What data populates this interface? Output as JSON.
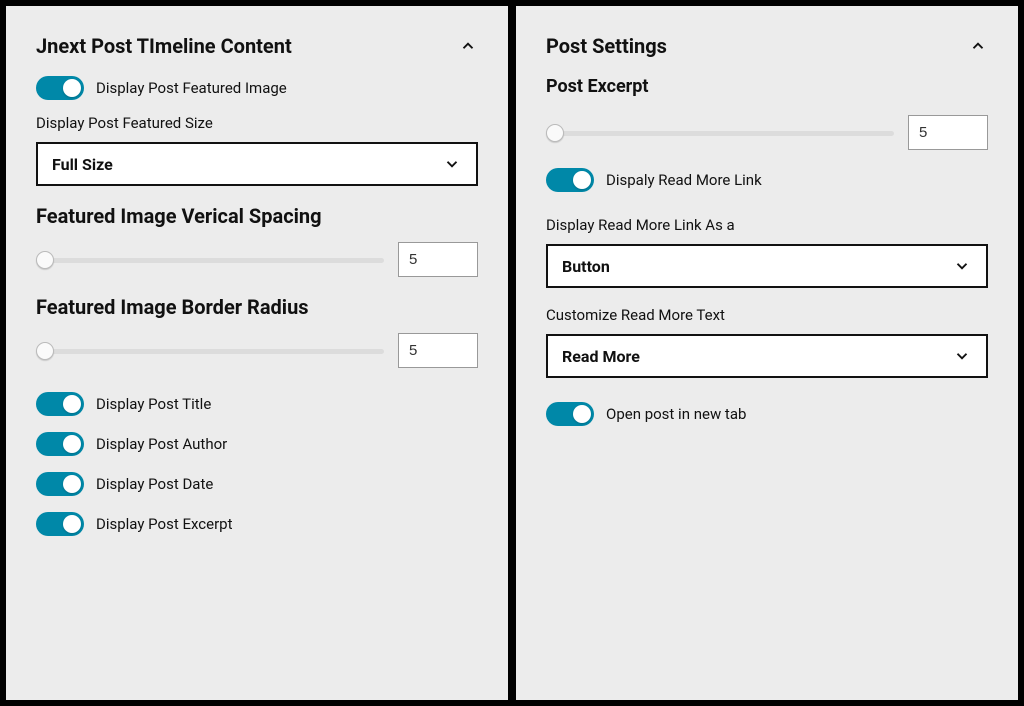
{
  "left": {
    "title": "Jnext Post TImeline Content",
    "display_featured_image": "Display Post Featured Image",
    "display_featured_size_label": "Display Post Featured Size",
    "display_featured_size_value": "Full Size",
    "vertical_spacing_label": "Featured Image Verical Spacing",
    "vertical_spacing_value": "5",
    "border_radius_label": "Featured Image Border Radius",
    "border_radius_value": "5",
    "toggle_title": "Display Post Title",
    "toggle_author": "Display Post Author",
    "toggle_date": "Display Post Date",
    "toggle_excerpt": "Display Post Excerpt"
  },
  "right": {
    "title": "Post Settings",
    "excerpt_label": "Post Excerpt",
    "excerpt_value": "5",
    "display_read_more": "Dispaly Read More Link",
    "read_more_as_label": "Display Read More Link As a",
    "read_more_as_value": "Button",
    "customize_text_label": "Customize Read More Text",
    "customize_text_value": "Read More",
    "open_new_tab": "Open post in new tab"
  }
}
